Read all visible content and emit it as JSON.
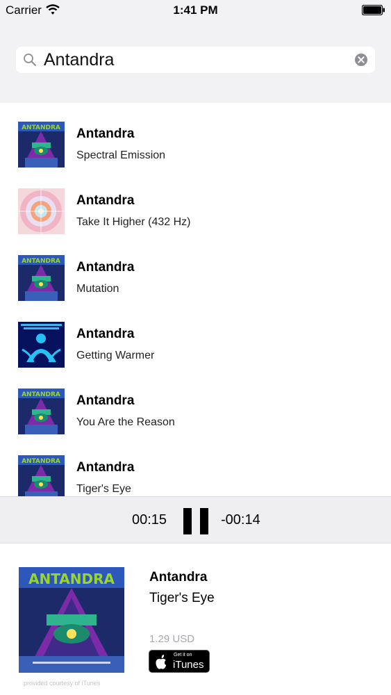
{
  "status_bar": {
    "carrier": "Carrier",
    "time": "1:41 PM",
    "icons": [
      "wifi-icon",
      "battery-icon"
    ]
  },
  "search": {
    "query": "Antandra",
    "icons": [
      "search-icon",
      "clear-icon"
    ]
  },
  "results": [
    {
      "artist": "Antandra",
      "title": "Spectral Emission",
      "art": "retinement"
    },
    {
      "artist": "Antandra",
      "title": "Take It Higher (432 Hz)",
      "art": "mandala"
    },
    {
      "artist": "Antandra",
      "title": "Mutation",
      "art": "retinement"
    },
    {
      "artist": "Antandra",
      "title": "Getting Warmer",
      "art": "welcome"
    },
    {
      "artist": "Antandra",
      "title": "You Are the Reason",
      "art": "retinement"
    },
    {
      "artist": "Antandra",
      "title": "Tiger's Eye",
      "art": "retinement"
    }
  ],
  "player": {
    "elapsed": "00:15",
    "remaining": "-00:14",
    "state_icon": "pause-icon"
  },
  "now_playing": {
    "artist": "Antandra",
    "title": "Tiger's Eye",
    "price": "1.29 USD",
    "badge_small": "Get it on",
    "badge_big": "iTunes",
    "courtesy": "provided courtesy of iTunes"
  },
  "colors": {
    "header_bg": "#f2f2f4",
    "player_bg": "#efeff1",
    "price_gray": "#a8a8ae"
  }
}
